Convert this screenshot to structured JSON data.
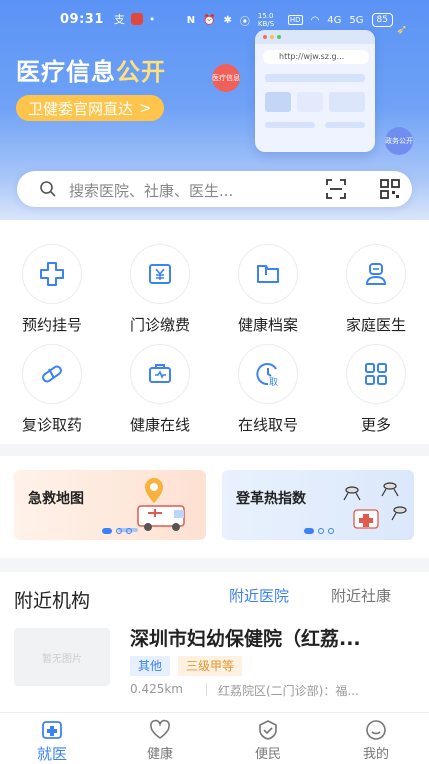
{
  "status_bar": {
    "time": "09:31",
    "icons_left": [
      "支",
      "•"
    ],
    "network": "15.0 KB/S",
    "hd": "HD",
    "signal1": "4G",
    "signal2": "5G",
    "battery": "85"
  },
  "hero": {
    "title_main": "医疗信息",
    "title_accent": "公开",
    "link_label": "卫健委官网直达",
    "link_arrow": ">",
    "illustration_url": "http://wjw.sz.g...",
    "badge_left": "医疗信息",
    "badge_right": "政务公开"
  },
  "search": {
    "placeholder": "搜索医院、社康、医生..."
  },
  "services": [
    {
      "label": "预约挂号",
      "icon": "plus-cross-icon"
    },
    {
      "label": "门诊缴费",
      "icon": "yuan-wallet-icon"
    },
    {
      "label": "健康档案",
      "icon": "folder-icon"
    },
    {
      "label": "家庭医生",
      "icon": "doctor-icon"
    },
    {
      "label": "复诊取药",
      "icon": "pill-icon"
    },
    {
      "label": "健康在线",
      "icon": "medical-kit-icon"
    },
    {
      "label": "在线取号",
      "icon": "clock-ticket-icon"
    },
    {
      "label": "更多",
      "icon": "grid-icon"
    }
  ],
  "service_icon_glyph": {
    "clock_ticket": "取"
  },
  "banners": [
    {
      "title": "急救地图"
    },
    {
      "title": "登革热指数"
    }
  ],
  "nearby": {
    "title": "附近机构",
    "tabs": [
      "附近医院",
      "附近社康"
    ],
    "institution": {
      "name": "深圳市妇幼保健院（红荔...",
      "tags": [
        "其他",
        "三级甲等"
      ],
      "distance": "0.425km",
      "address": "红荔院区(二门诊部)：福..."
    },
    "thumb_text": "暂无图片"
  },
  "tabbar": [
    {
      "label": "就医",
      "icon": "hospital-icon"
    },
    {
      "label": "健康",
      "icon": "heart-icon"
    },
    {
      "label": "便民",
      "icon": "shield-icon"
    },
    {
      "label": "我的",
      "icon": "smile-icon"
    }
  ],
  "colors": {
    "accent": "#3b82f6",
    "hero_gold": "#ffc44c",
    "tag_orange": "#e3962f"
  }
}
